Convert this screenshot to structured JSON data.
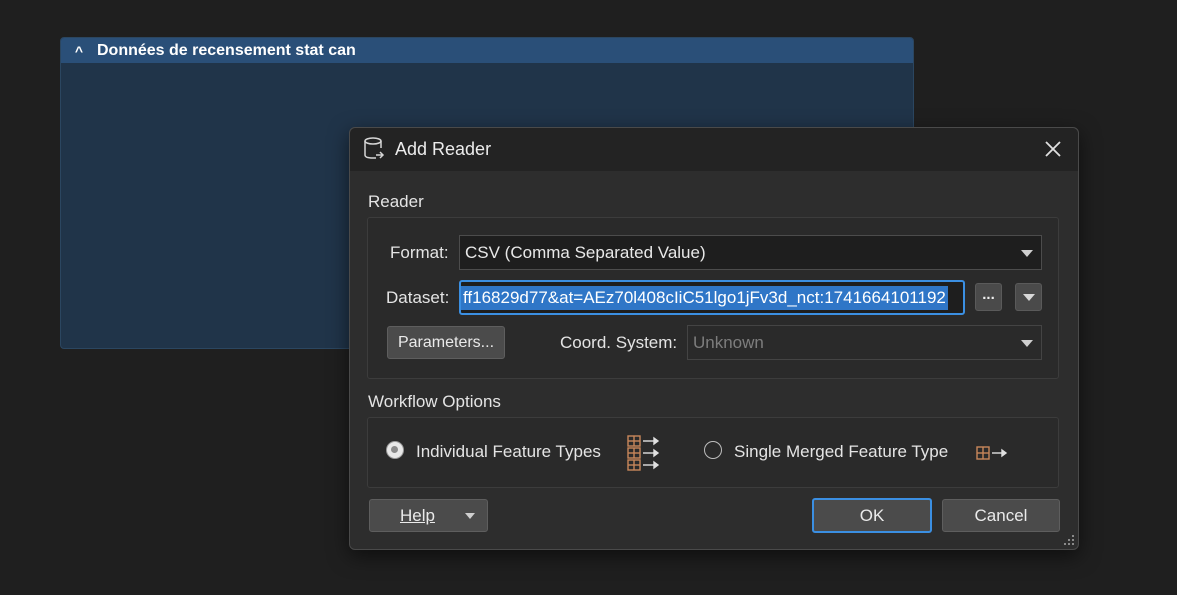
{
  "bookmark": {
    "chevron": "^",
    "title": "Données de recensement stat can"
  },
  "dialog": {
    "title": "Add Reader",
    "reader_section": "Reader",
    "format_label": "Format:",
    "format_value": "CSV (Comma Separated Value)",
    "dataset_label": "Dataset:",
    "dataset_value": "ff16829d77&at=AEz70l408cIiC51lgo1jFv3d_nct:1741664101192",
    "browse_label": "...",
    "parameters_label": "Parameters...",
    "coord_label": "Coord. System:",
    "coord_value": "Unknown",
    "workflow_section": "Workflow Options",
    "options": [
      {
        "label": "Individual Feature Types",
        "checked": true
      },
      {
        "label": "Single Merged Feature Type",
        "checked": false
      }
    ],
    "help_label": "Help",
    "ok_label": "OK",
    "cancel_label": "Cancel"
  },
  "colors": {
    "accent": "#3b8fe2",
    "selection": "#2f76c7",
    "bookmark_header": "#2a4f78",
    "feature_icon": "#c8875a"
  },
  "icons": {
    "app": "database-reader-icon",
    "close": "close-icon",
    "individual": "multi-feature-types-icon",
    "merged": "single-feature-type-icon",
    "grip": "resize-grip-icon"
  }
}
